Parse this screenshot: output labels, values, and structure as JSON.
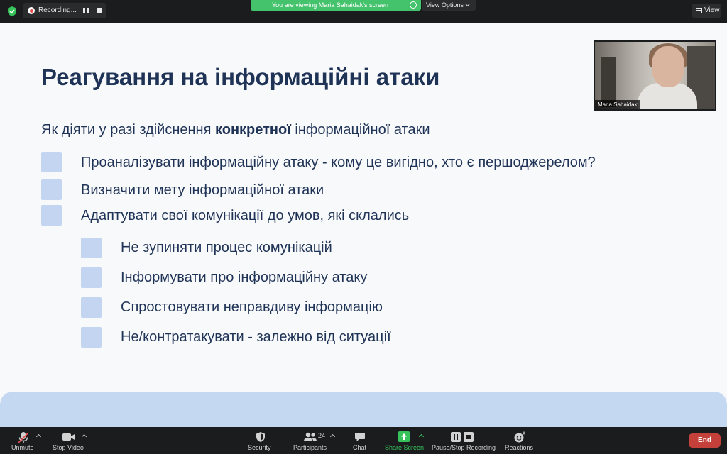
{
  "topbar": {
    "recording_label": "Recording...",
    "viewing_banner": "You are viewing Maria Sahaidak's screen",
    "view_options_label": "View Options",
    "view_label": "View"
  },
  "slide": {
    "title": "Реагування на інформаційні атаки",
    "subtitle_prefix": "Як діяти у разі здійснення ",
    "subtitle_bold": "конкретної",
    "subtitle_suffix": " інформаційної атаки",
    "items": [
      "Проаналізувати інформаційну атаку - кому це вигідно, хто є першоджерелом?",
      "Визначити  мету інформаційної атаки",
      "Адаптувати свої комунікації до умов, які склались"
    ],
    "sub_items": [
      "Не зупиняти процес комунікацій",
      "Інформувати про інформаційну атаку",
      "Спростовувати неправдиву інформацію",
      "Не/контратакувати - залежно від ситуації"
    ],
    "accent_color": "#c3d5f0",
    "text_color": "#1f3356"
  },
  "video": {
    "participant_name": "Maria Sahaidak"
  },
  "toolbar": {
    "unmute": "Unmute",
    "stop_video": "Stop Video",
    "security": "Security",
    "participants": "Participants",
    "participants_count": "24",
    "chat": "Chat",
    "share_screen": "Share Screen",
    "pause_stop_recording": "Pause/Stop Recording",
    "reactions": "Reactions",
    "end": "End",
    "share_color": "#35c25a",
    "end_color": "#c4403a"
  }
}
